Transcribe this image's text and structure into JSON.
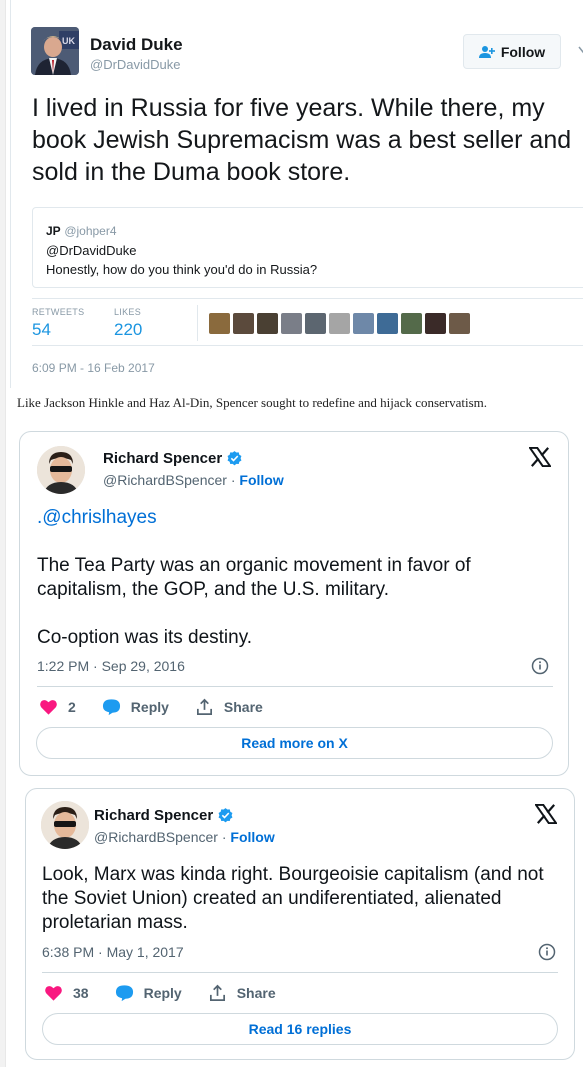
{
  "classic_tweet": {
    "author_name": "David Duke",
    "author_handle": "@DrDavidDuke",
    "follow_label": "Follow",
    "text": "I lived in Russia for five years. While there, my book Jewish Supremacism was a best seller and sold in the Duma book store.",
    "quoted": {
      "name": "JP",
      "handle": "@johper4",
      "mention": "@DrDavidDuke",
      "text": "Honestly, how do you think you'd do in Russia?"
    },
    "stats": {
      "retweets_label": "RETWEETS",
      "retweets": "54",
      "likes_label": "LIKES",
      "likes": "220"
    },
    "liker_colors": [
      "#8a6a3d",
      "#5b4a3c",
      "#4a4033",
      "#7a7e88",
      "#5c6670",
      "#a5a5a5",
      "#6e88a8",
      "#3e6b96",
      "#546a4a",
      "#3a2a28",
      "#6d5a48"
    ],
    "timestamp": "6:09 PM - 16 Feb 2017"
  },
  "caption": "Like Jackson Hinkle and Haz Al-Din, Spencer sought to redefine and hijack conservatism.",
  "embed_1": {
    "author_name": "Richard Spencer",
    "author_handle": "@RichardBSpencer",
    "separator": " · ",
    "follow_label": "Follow",
    "mention": ".@chrislhayes",
    "paragraph_1": "The Tea Party was an organic movement in favor of capitalism, the GOP, and the U.S. military.",
    "paragraph_2": "Co-option was its destiny.",
    "timestamp": "1:22 PM · Sep 29, 2016",
    "like_count": "2",
    "reply_label": "Reply",
    "share_label": "Share",
    "read_more_label": "Read more on X"
  },
  "embed_2": {
    "author_name": "Richard Spencer",
    "author_handle": "@RichardBSpencer",
    "separator": " · ",
    "follow_label": "Follow",
    "text": "Look, Marx was kinda right. Bourgeoisie capitalism (and not the Soviet Union) created an undiferentiated, alienated proletarian mass.",
    "timestamp": "6:38 PM · May 1, 2017",
    "like_count": "38",
    "reply_label": "Reply",
    "share_label": "Share",
    "read_more_label": "Read 16 replies"
  },
  "colors": {
    "link_blue": "#1b95e0",
    "x_blue": "#006fd6",
    "like_pink": "#f91880",
    "verified_blue": "#1d9bf0"
  }
}
